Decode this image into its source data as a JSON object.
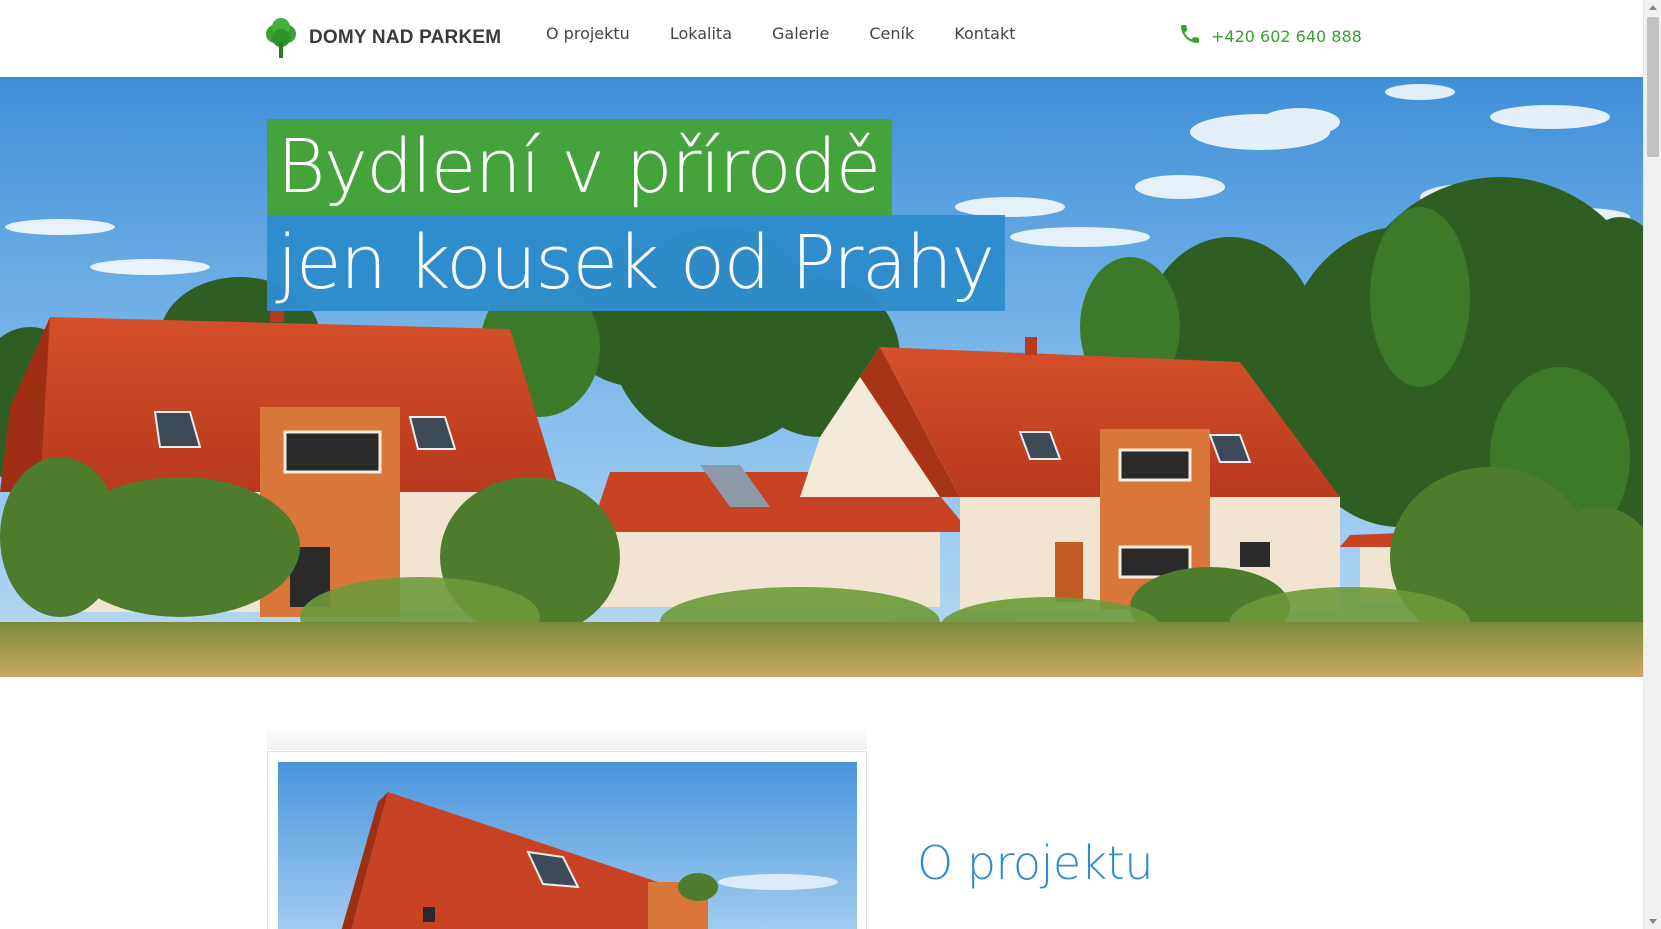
{
  "header": {
    "logo_text": "DOMY NAD PARKEM",
    "nav": [
      "O projektu",
      "Lokalita",
      "Galerie",
      "Ceník",
      "Kontakt"
    ],
    "phone": "+420 602 640 888"
  },
  "hero": {
    "line1": "Bydlení v přírodě",
    "line2": "jen kousek od Prahy"
  },
  "about": {
    "title": "O projektu"
  },
  "colors": {
    "green": "#44a33a",
    "blue": "#2f8dcd",
    "phone_green": "#3aa12f"
  },
  "icons": [
    "tree-logo-icon",
    "phone-icon"
  ]
}
